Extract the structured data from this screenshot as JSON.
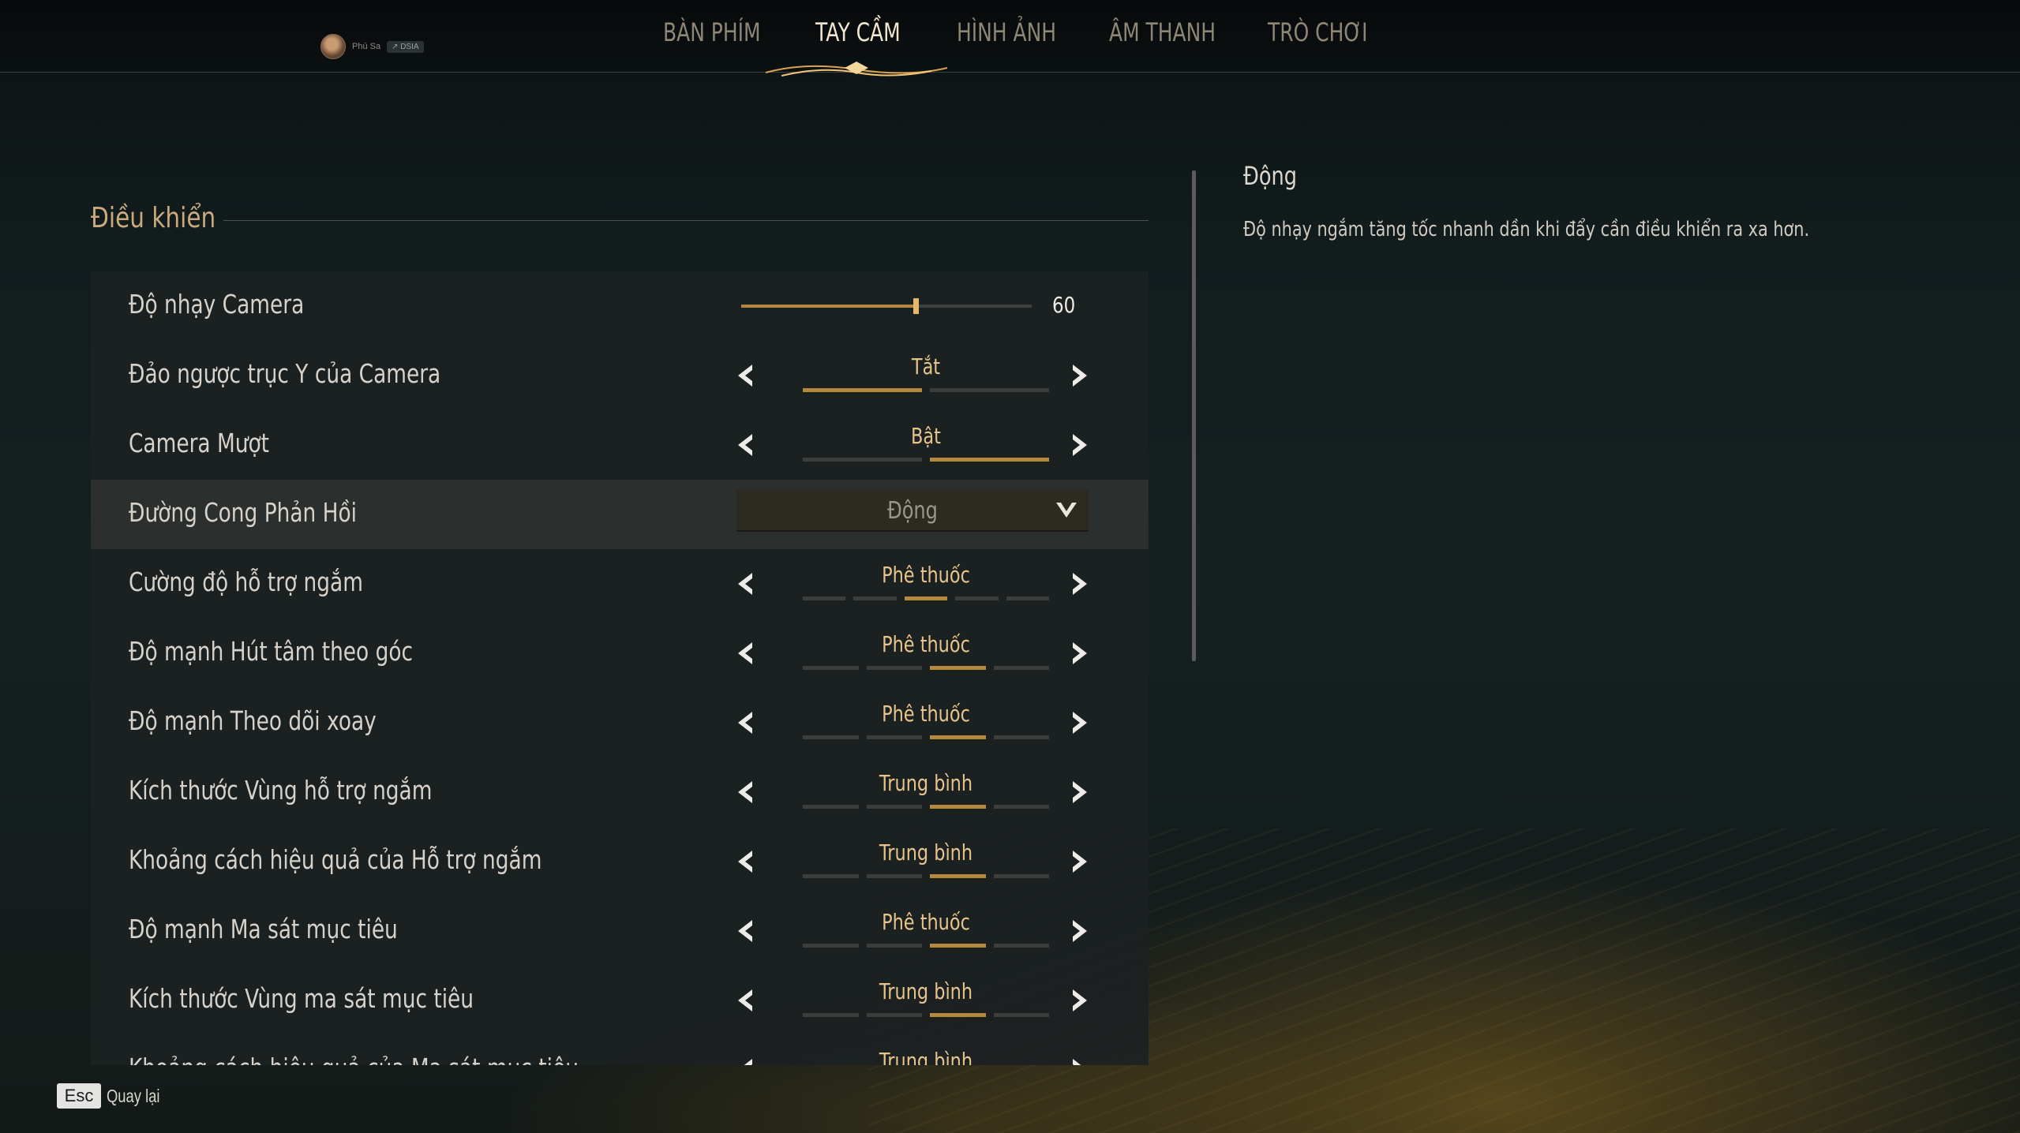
{
  "profile": {
    "name": "Phú Sa",
    "badge": "↗ DSIA"
  },
  "tabs": [
    {
      "label": "BÀN PHÍM",
      "active": false
    },
    {
      "label": "TAY CẦM",
      "active": true
    },
    {
      "label": "HÌNH ẢNH",
      "active": false
    },
    {
      "label": "ÂM THANH",
      "active": false
    },
    {
      "label": "TRÒ CHƠI",
      "active": false
    }
  ],
  "section": {
    "title": "Điều khiển"
  },
  "settings": {
    "camera_sensitivity": {
      "label": "Độ nhạy Camera",
      "value": "60",
      "fraction": 0.6
    },
    "invert_y": {
      "label": "Đảo ngược trục Y của Camera",
      "value": "Tắt",
      "level": 1,
      "segments": 2
    },
    "smooth_camera": {
      "label": "Camera Mượt",
      "value": "Bật",
      "level": 2,
      "segments": 2
    },
    "response_curve": {
      "label": "Đường Cong Phản Hồi",
      "value": "Động"
    },
    "aim_assist_strength": {
      "label": "Cường độ hỗ trợ ngắm",
      "value": "Phê thuốc",
      "level": 3,
      "segments": 5
    },
    "snap_strength": {
      "label": "Độ mạnh Hút tâm theo góc",
      "value": "Phê thuốc",
      "level": 3,
      "segments": 4
    },
    "rotation_strength": {
      "label": "Độ mạnh Theo dõi xoay",
      "value": "Phê thuốc",
      "level": 3,
      "segments": 4
    },
    "aim_zone_size": {
      "label": "Kích thước Vùng hỗ trợ ngắm",
      "value": "Trung bình",
      "level": 3,
      "segments": 4
    },
    "aim_effective_range": {
      "label": "Khoảng cách hiệu quả của Hỗ trợ ngắm",
      "value": "Trung bình",
      "level": 3,
      "segments": 4
    },
    "friction_strength": {
      "label": "Độ mạnh Ma sát mục tiêu",
      "value": "Phê thuốc",
      "level": 3,
      "segments": 4
    },
    "friction_zone_size": {
      "label": "Kích thước Vùng ma sát mục tiêu",
      "value": "Trung bình",
      "level": 3,
      "segments": 4
    },
    "friction_range": {
      "label": "Khoảng cách hiệu quả của Ma sát mục tiêu",
      "value": "Trung bình",
      "level": 3,
      "segments": 4
    }
  },
  "description": {
    "title": "Động",
    "text": "Độ nhạy ngắm tăng tốc nhanh dần khi đẩy cần điều khiển ra xa hơn."
  },
  "footer": {
    "key": "Esc",
    "label": "Quay lại"
  },
  "colors": {
    "accent": "#b58a3c",
    "value_text": "#e6c58c",
    "title": "#c9a97d"
  },
  "icons": {
    "left": "chevron-left-icon",
    "right": "chevron-right-icon",
    "dropdown": "chevron-down-icon"
  }
}
